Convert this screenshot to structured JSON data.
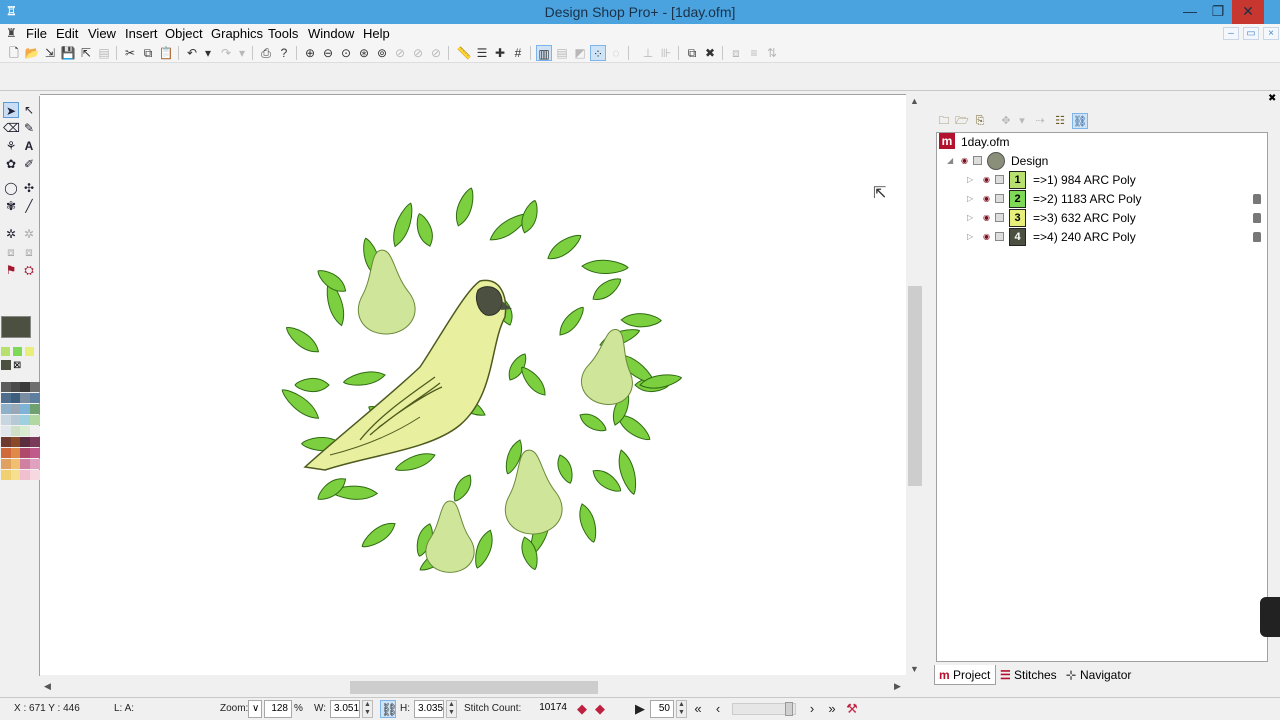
{
  "window": {
    "title": "Design Shop Pro+ - [1day.ofm]"
  },
  "menu": [
    "File",
    "Edit",
    "View",
    "Insert",
    "Object",
    "Graphics",
    "Tools",
    "Window",
    "Help"
  ],
  "project_tree": {
    "root": "1day.ofm",
    "design": "Design",
    "layers": [
      {
        "num": "1",
        "label": "=>1) 984 ARC Poly",
        "color": "#b7e06e",
        "locked": false
      },
      {
        "num": "2",
        "label": "=>2) 1183 ARC Poly",
        "color": "#7ed957",
        "locked": true
      },
      {
        "num": "3",
        "label": "=>3) 632 ARC Poly",
        "color": "#e7ef7a",
        "locked": true
      },
      {
        "num": "4",
        "label": "=>4) 240 ARC Poly",
        "color": "#4b5041",
        "locked": true
      }
    ]
  },
  "tabs": [
    "Project",
    "Stitches",
    "Navigator"
  ],
  "status": {
    "coords": "X : 671  Y : 446",
    "layer": "L: A:",
    "zoom_label": "Zoom:",
    "zoom_value": "128",
    "zoom_unit": "%",
    "w_label": "W:",
    "w_value": "3.051",
    "h_label": "H:",
    "h_value": "3.035",
    "stitch_label": "Stitch Count:",
    "stitch_value": "10174",
    "speed_value": "50"
  },
  "colors": {
    "accent": "#4aa3df",
    "leaf": "#7ccf3f",
    "leaf_dark": "#2f6b12",
    "pear": "#cfe59a",
    "bird": "#e8f0a0",
    "eye": "#4b5041"
  }
}
